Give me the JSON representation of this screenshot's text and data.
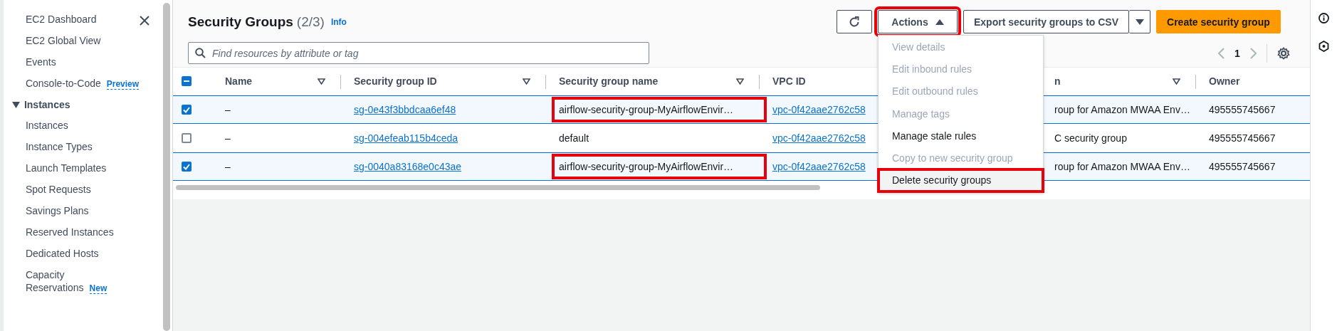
{
  "sidebar": {
    "items": [
      {
        "kind": "link",
        "label": "EC2 Dashboard"
      },
      {
        "kind": "link",
        "label": "EC2 Global View"
      },
      {
        "kind": "link",
        "label": "Events"
      },
      {
        "kind": "link",
        "label": "Console-to-Code",
        "badge": "Preview"
      },
      {
        "kind": "section",
        "label": "Instances",
        "expanded": true,
        "children": [
          {
            "kind": "link",
            "label": "Instances"
          },
          {
            "kind": "link",
            "label": "Instance Types"
          },
          {
            "kind": "link",
            "label": "Launch Templates"
          },
          {
            "kind": "link",
            "label": "Spot Requests"
          },
          {
            "kind": "link",
            "label": "Savings Plans"
          },
          {
            "kind": "link",
            "label": "Reserved Instances"
          },
          {
            "kind": "link",
            "label": "Dedicated Hosts"
          },
          {
            "kind": "link",
            "label": "Capacity Reservations",
            "badge": "New"
          }
        ]
      }
    ]
  },
  "header": {
    "title": "Security Groups",
    "count": "(2/3)",
    "info": "Info",
    "buttons": [
      {
        "kind": "refresh",
        "highlighted": false
      },
      {
        "kind": "dropdown",
        "label": "Actions",
        "expanded": true,
        "highlighted": true
      },
      {
        "kind": "split",
        "label": "Export security groups to CSV",
        "highlighted": false
      },
      {
        "kind": "primary",
        "label": "Create security group",
        "highlighted": false
      }
    ],
    "search": {
      "placeholder": "Find resources by attribute or tag"
    },
    "pagination": {
      "page": "1"
    }
  },
  "table": {
    "select_all_indeterminate": true,
    "columns": [
      {
        "label": "Name",
        "kind": "text",
        "filter": true
      },
      {
        "label": "Security group ID",
        "kind": "link",
        "filter": true
      },
      {
        "label": "Security group name",
        "kind": "text",
        "filter": true
      },
      {
        "label": "VPC ID",
        "kind": "link"
      },
      {
        "kind": "hidden"
      },
      {
        "label": "n",
        "kind": "text",
        "filter": true
      },
      {
        "label": "Owner",
        "kind": "text"
      }
    ],
    "rows": [
      {
        "selected": true,
        "cells": [
          "–",
          "sg-0e43f3bbdcaa6ef48",
          {
            "text": "airflow-security-group-MyAirflowEnvir…",
            "highlighted": true
          },
          "vpc-0f42aae2762c58",
          "",
          "roup for Amazon MWAA Env…",
          "495555745667"
        ]
      },
      {
        "selected": false,
        "cells": [
          "–",
          "sg-004efeab115b4ceda",
          {
            "text": "default",
            "highlighted": false
          },
          "vpc-0f42aae2762c58",
          "",
          "C security group",
          "495555745667"
        ]
      },
      {
        "selected": true,
        "cells": [
          "–",
          "sg-0040a83168e0c43ae",
          {
            "text": "airflow-security-group-MyAirflowEnvir…",
            "highlighted": true
          },
          "vpc-0f42aae2762c58",
          "",
          "roup for Amazon MWAA Env…",
          "495555745667"
        ]
      }
    ]
  },
  "menu": {
    "items": [
      {
        "label": "View details",
        "disabled": true,
        "highlighted": false
      },
      {
        "label": "Edit inbound rules",
        "disabled": true,
        "highlighted": false
      },
      {
        "label": "Edit outbound rules",
        "disabled": true,
        "highlighted": false
      },
      {
        "label": "Manage tags",
        "disabled": true,
        "highlighted": false
      },
      {
        "label": "Manage stale rules",
        "disabled": false,
        "highlighted": false
      },
      {
        "label": "Copy to new security group",
        "disabled": true,
        "highlighted": false
      },
      {
        "label": "Delete security groups",
        "disabled": false,
        "highlighted": true
      }
    ]
  }
}
